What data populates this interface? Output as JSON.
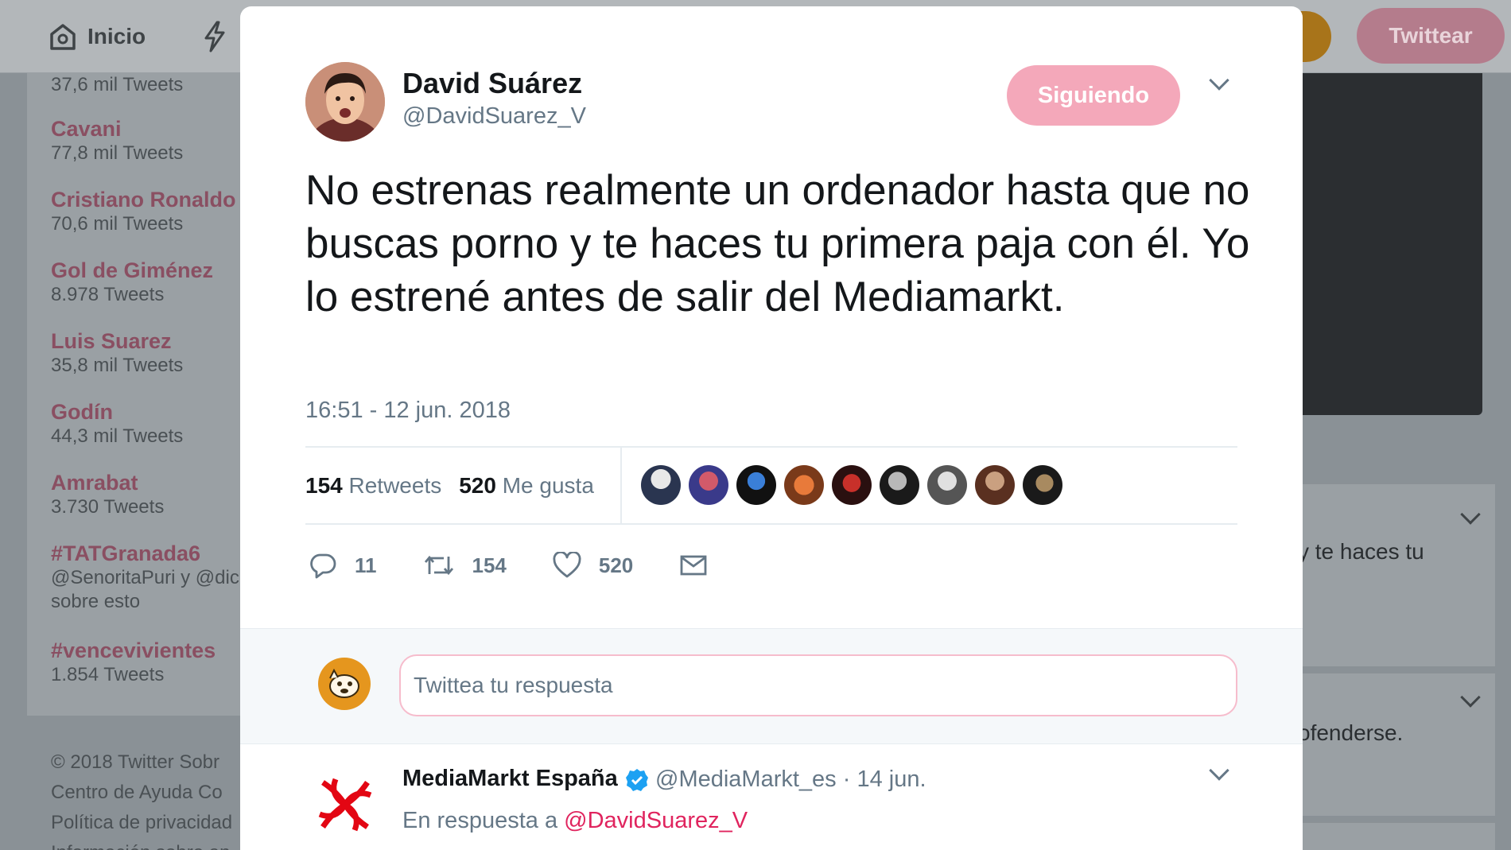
{
  "topbar": {
    "home_label": "Inicio",
    "tweet_button": "Twittear"
  },
  "trends": [
    {
      "name": "",
      "count": "37,6 mil Tweets"
    },
    {
      "name": "Cavani",
      "count": "77,8 mil Tweets"
    },
    {
      "name": "Cristiano Ronaldo",
      "count": "70,6 mil Tweets"
    },
    {
      "name": "Gol de Giménez",
      "count": "8.978 Tweets"
    },
    {
      "name": "Luis Suarez",
      "count": "35,8 mil Tweets"
    },
    {
      "name": "Godín",
      "count": "44,3 mil Tweets"
    },
    {
      "name": "Amrabat",
      "count": "3.730 Tweets"
    },
    {
      "name": "#TATGranada6",
      "count": "@SenoritaPuri y @dic",
      "count2": "sobre esto"
    },
    {
      "name": "#vencevivientes",
      "count": "1.854 Tweets"
    }
  ],
  "footer": {
    "line1": "© 2018 Twitter   Sobr",
    "line2": "Centro de Ayuda   Co",
    "line3": "Política de privacidad",
    "line4": "Información sobre an"
  },
  "background_timeline": {
    "snippet1": "y te haces tu",
    "snippet2": "ofenderse."
  },
  "tweet": {
    "author_name": "David Suárez",
    "author_handle": "@DavidSuarez_V",
    "follow_label": "Siguiendo",
    "text": "No estrenas realmente un ordenador hasta que no buscas porno y te haces tu primera paja con él. Yo lo estrené antes de salir del Mediamarkt.",
    "timestamp": "16:51 - 12 jun. 2018",
    "retweets_count": "154",
    "retweets_label": "Retweets",
    "likes_count": "520",
    "likes_label": "Me gusta",
    "reply_count": "11",
    "retweet_action_count": "154",
    "like_action_count": "520"
  },
  "reply_box": {
    "placeholder": "Twittea tu respuesta"
  },
  "reply_tweet": {
    "author_name": "MediaMarkt España",
    "meta": "@MediaMarkt_es · 14 jun.",
    "in_reply_prefix": "En respuesta a",
    "in_reply_handle": "@DavidSuarez_V"
  },
  "colors": {
    "accent": "#e0245e",
    "follow_button": "#f4a8ba",
    "muted_text": "#657786",
    "verified": "#1da1f2"
  }
}
